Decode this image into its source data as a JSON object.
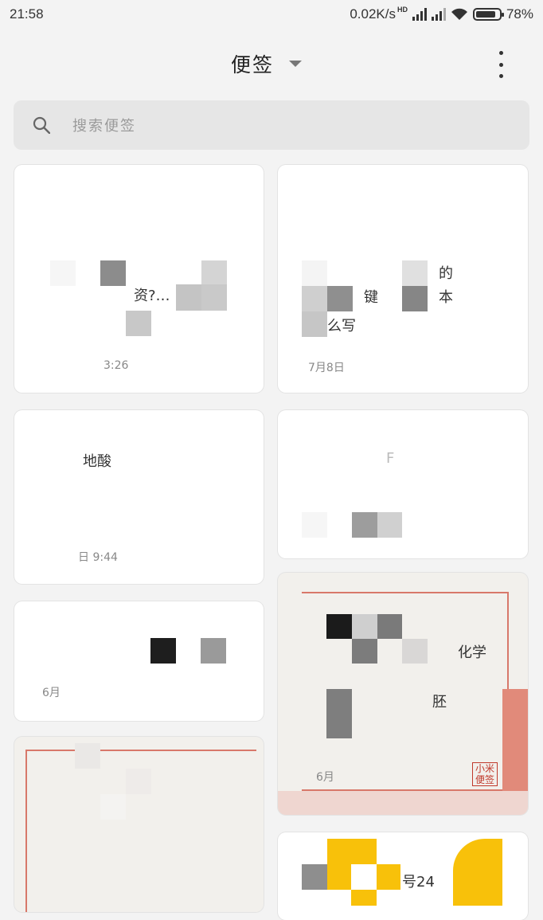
{
  "status_bar": {
    "time": "21:58",
    "network_speed": "0.02K/s",
    "hd_badge": "HD",
    "battery": "78%"
  },
  "header": {
    "title": "便签",
    "dropdown_icon": "caret-down-icon",
    "menu_icon": "more-vertical-icon"
  },
  "search": {
    "placeholder": "搜索便签",
    "icon": "search-icon"
  },
  "notes": [
    {
      "text": "资?…",
      "date": "3:26"
    },
    {
      "text_lines": [
        "的",
        "键",
        "本",
        "么写"
      ],
      "date": "7月8日"
    },
    {
      "text": "地酸",
      "date": "日 9:44"
    },
    {
      "text": "F"
    },
    {
      "date": "6月"
    },
    {
      "text_lines": [
        "化学",
        "胚"
      ],
      "date": "6月",
      "stamp": "小米便签"
    },
    {
      "text": "号24"
    }
  ]
}
